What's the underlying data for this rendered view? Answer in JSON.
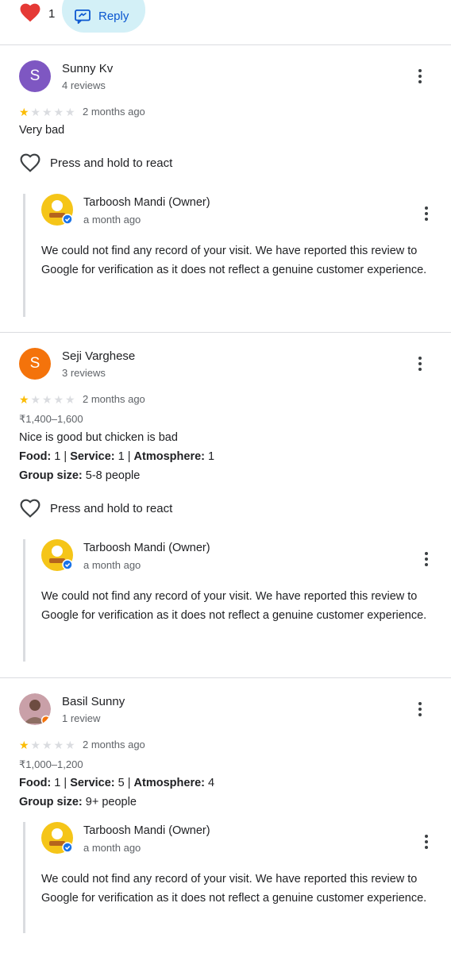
{
  "top": {
    "reaction_count": "1",
    "reply_label": "Reply"
  },
  "reviews": [
    {
      "avatar_letter": "S",
      "avatar_color": "#7e57c2",
      "name": "Sunny Kv",
      "review_count": "4 reviews",
      "rating": 1,
      "time": "2 months ago",
      "text": "Very bad",
      "react_label": "Press and hold to react",
      "owner": {
        "name": "Tarboosh Mandi (Owner)",
        "time": "a month ago",
        "text": "We could not find any record of your visit. We have reported this review to Google for verification as it does not reflect a genuine customer experience."
      }
    },
    {
      "avatar_letter": "S",
      "avatar_color": "#f4730b",
      "name": "Seji Varghese",
      "review_count": "3 reviews",
      "rating": 1,
      "time": "2 months ago",
      "price": "₹1,400–1,600",
      "text": "Nice is good but chicken is bad",
      "food_label": "Food:",
      "food_value": " 1 | ",
      "service_label": "Service:",
      "service_value": " 1 | ",
      "atmosphere_label": "Atmosphere:",
      "atmosphere_value": " 1",
      "group_label": "Group size:",
      "group_value": " 5-8 people",
      "react_label": "Press and hold to react",
      "owner": {
        "name": "Tarboosh Mandi (Owner)",
        "time": "a month ago",
        "text": "We could not find any record of your visit. We have reported this review to Google for verification as it does not reflect a genuine customer experience."
      }
    },
    {
      "name": "Basil Sunny",
      "review_count": "1 review",
      "rating": 1,
      "time": "2 months ago",
      "price": "₹1,000–1,200",
      "food_label": "Food:",
      "food_value": " 1 | ",
      "service_label": "Service:",
      "service_value": " 5 | ",
      "atmosphere_label": "Atmosphere:",
      "atmosphere_value": " 4",
      "group_label": "Group size:",
      "group_value": " 9+ people",
      "owner": {
        "name": "Tarboosh Mandi (Owner)",
        "time": "a month ago",
        "text": "We could not find any record of your visit. We have reported this review to Google for verification as it does not reflect a genuine customer experience."
      }
    }
  ],
  "colors": {
    "star": "#fbbc04",
    "star_empty": "#dadce0",
    "reply_bg": "#d3f0f7",
    "accent": "#0b57d0",
    "heart": "#e53935"
  },
  "icons": [
    "heart-icon",
    "reply-icon",
    "more-vert-icon",
    "star-icon",
    "heart-outline-icon",
    "verified-badge-icon",
    "local-guide-badge-icon"
  ]
}
